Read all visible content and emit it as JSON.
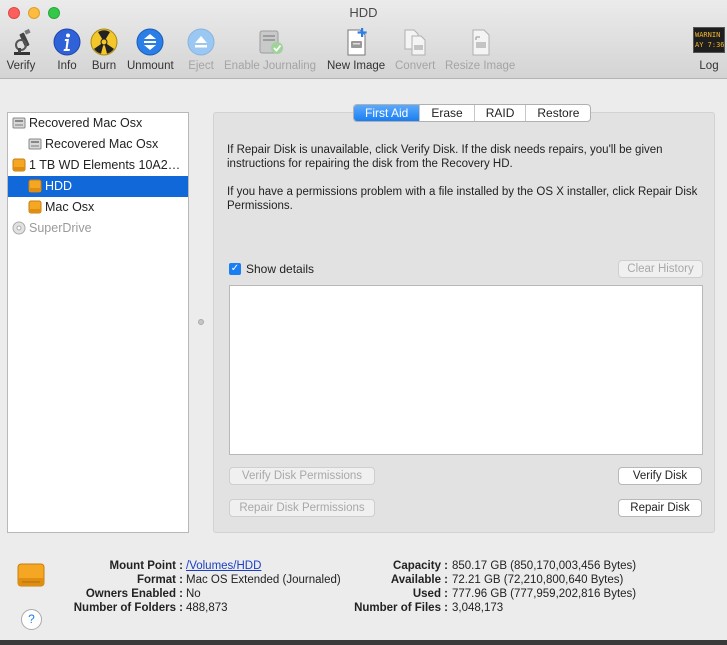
{
  "window": {
    "title": "HDD"
  },
  "toolbar": {
    "items": [
      {
        "label": "Verify",
        "icon": "microscope-icon",
        "enabled": true
      },
      {
        "label": "Info",
        "icon": "info-icon",
        "enabled": true
      },
      {
        "label": "Burn",
        "icon": "burn-icon",
        "enabled": true
      },
      {
        "label": "Unmount",
        "icon": "unmount-icon",
        "enabled": true
      },
      {
        "label": "Eject",
        "icon": "eject-icon",
        "enabled": false
      },
      {
        "label": "Enable Journaling",
        "icon": "journaling-icon",
        "enabled": false
      },
      {
        "label": "New Image",
        "icon": "new-image-icon",
        "enabled": true
      },
      {
        "label": "Convert",
        "icon": "convert-icon",
        "enabled": false
      },
      {
        "label": "Resize Image",
        "icon": "resize-image-icon",
        "enabled": false
      }
    ],
    "log": {
      "label": "Log",
      "icon_text_1": "WARNIN",
      "icon_text_2": "AY 7:36"
    }
  },
  "sidebar": {
    "items": [
      {
        "label": "Recovered Mac Osx",
        "icon": "disk-image-icon",
        "level": 0,
        "selected": false,
        "enabled": true
      },
      {
        "label": "Recovered Mac Osx",
        "icon": "disk-image-volume-icon",
        "level": 1,
        "selected": false,
        "enabled": true
      },
      {
        "label": "1 TB WD Elements 10A2…",
        "icon": "external-drive-icon",
        "level": 0,
        "selected": false,
        "enabled": true
      },
      {
        "label": "HDD",
        "icon": "volume-icon",
        "level": 1,
        "selected": true,
        "enabled": true
      },
      {
        "label": "Mac Osx",
        "icon": "volume-icon",
        "level": 1,
        "selected": false,
        "enabled": true
      },
      {
        "label": "SuperDrive",
        "icon": "optical-drive-icon",
        "level": 0,
        "selected": false,
        "enabled": false
      }
    ]
  },
  "tabs": [
    {
      "label": "First Aid",
      "active": true
    },
    {
      "label": "Erase",
      "active": false
    },
    {
      "label": "RAID",
      "active": false
    },
    {
      "label": "Restore",
      "active": false
    }
  ],
  "first_aid": {
    "paragraph1": "If Repair Disk is unavailable, click Verify Disk. If the disk needs repairs, you'll be given instructions for repairing the disk from the Recovery HD.",
    "paragraph2": "If you have a permissions problem with a file installed by the OS X installer, click Repair Disk Permissions.",
    "show_details_label": "Show details",
    "show_details_checked": true,
    "clear_history": "Clear History",
    "verify_permissions": "Verify Disk Permissions",
    "repair_permissions": "Repair Disk Permissions",
    "verify_disk": "Verify Disk",
    "repair_disk": "Repair Disk"
  },
  "info": {
    "mount_point_label": "Mount Point :",
    "mount_point": "/Volumes/HDD",
    "format_label": "Format :",
    "format": "Mac OS Extended (Journaled)",
    "owners_label": "Owners Enabled :",
    "owners": "No",
    "folders_label": "Number of Folders :",
    "folders": "488,873",
    "capacity_label": "Capacity :",
    "capacity": "850.17 GB (850,170,003,456 Bytes)",
    "available_label": "Available :",
    "available": "72.21 GB (72,210,800,640 Bytes)",
    "used_label": "Used :",
    "used": "777.96 GB (777,959,202,816 Bytes)",
    "files_label": "Number of Files :",
    "files": "3,048,173",
    "help_label": "?"
  },
  "colors": {
    "selection": "#1169d9",
    "accent": "#1a7ef2",
    "drive_orange": "#f5a623"
  }
}
